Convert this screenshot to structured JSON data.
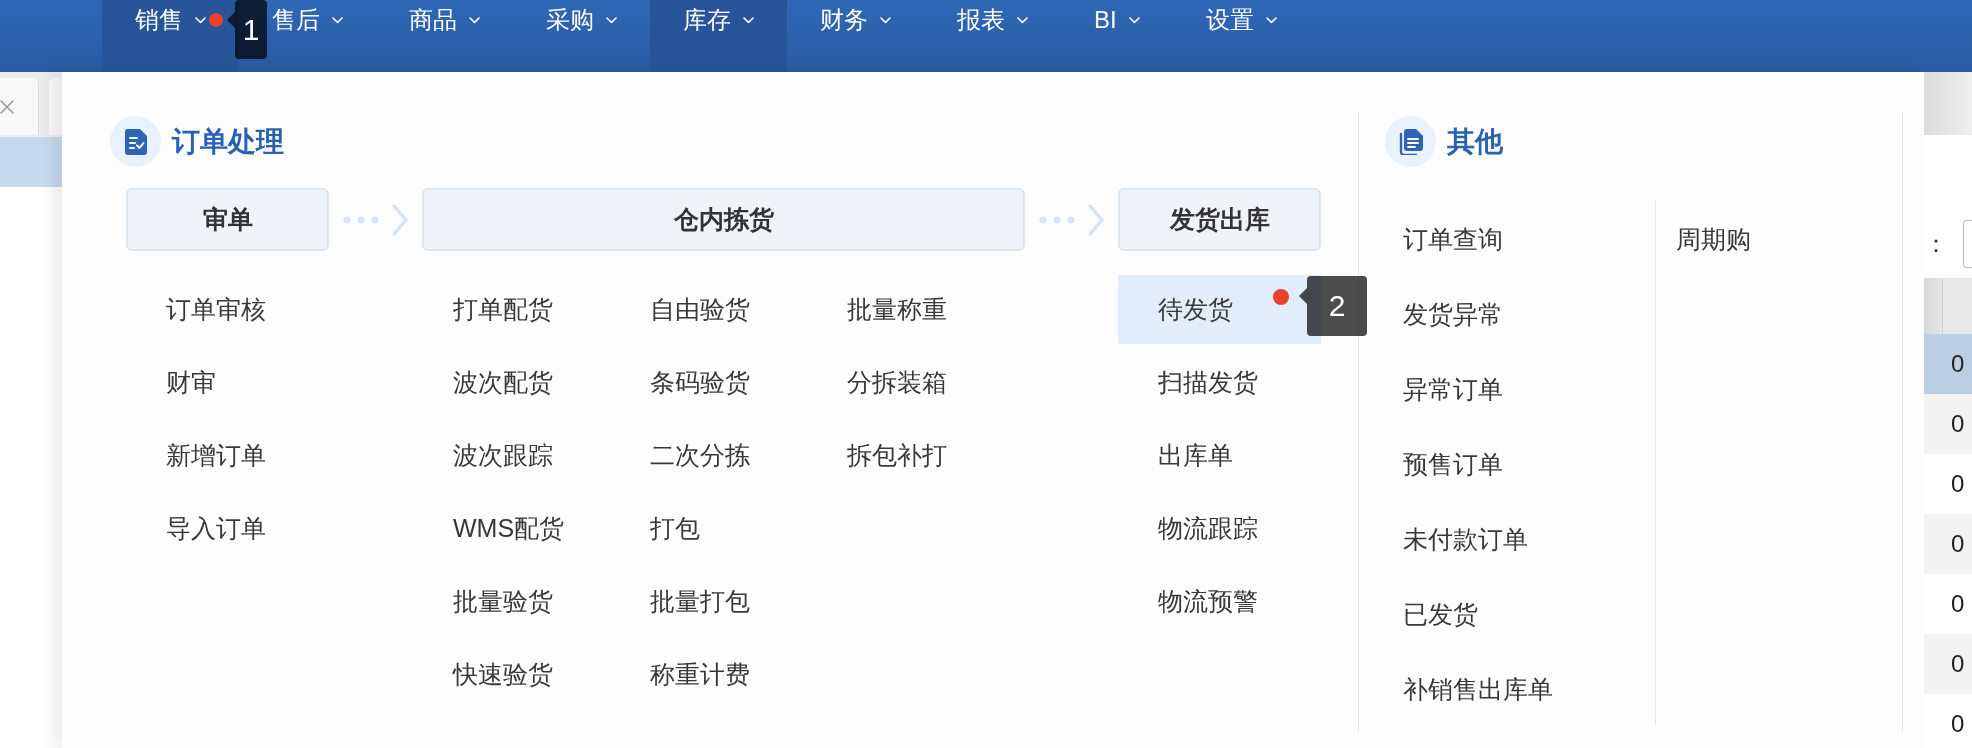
{
  "nav": {
    "items": [
      {
        "label": "销售",
        "highlighted": true,
        "annotation": "1"
      },
      {
        "label": "售后",
        "highlighted": false
      },
      {
        "label": "商品",
        "highlighted": false
      },
      {
        "label": "采购",
        "highlighted": false
      },
      {
        "label": "库存",
        "highlighted": true
      },
      {
        "label": "财务",
        "highlighted": false
      },
      {
        "label": "报表",
        "highlighted": false
      },
      {
        "label": "BI",
        "highlighted": false
      },
      {
        "label": "设置",
        "highlighted": false
      }
    ]
  },
  "menu": {
    "sections": [
      {
        "kind": "flow",
        "title": "订单处理",
        "stages": [
          {
            "label": "审单",
            "columns": [
              [
                {
                  "label": "订单审核",
                  "selected": false
                },
                {
                  "label": "财审",
                  "selected": false
                },
                {
                  "label": "新增订单",
                  "selected": false
                },
                {
                  "label": "导入订单",
                  "selected": false
                }
              ]
            ]
          },
          {
            "label": "仓内拣货",
            "columns": [
              [
                {
                  "label": "打单配货",
                  "selected": false
                },
                {
                  "label": "波次配货",
                  "selected": false
                },
                {
                  "label": "波次跟踪",
                  "selected": false
                },
                {
                  "label": "WMS配货",
                  "selected": false
                },
                {
                  "label": "批量验货",
                  "selected": false
                },
                {
                  "label": "快速验货",
                  "selected": false
                }
              ],
              [
                {
                  "label": "自由验货",
                  "selected": false
                },
                {
                  "label": "条码验货",
                  "selected": false
                },
                {
                  "label": "二次分拣",
                  "selected": false
                },
                {
                  "label": "打包",
                  "selected": false
                },
                {
                  "label": "批量打包",
                  "selected": false
                },
                {
                  "label": "称重计费",
                  "selected": false
                }
              ],
              [
                {
                  "label": "批量称重",
                  "selected": false
                },
                {
                  "label": "分拆装箱",
                  "selected": false
                },
                {
                  "label": "拆包补打",
                  "selected": false
                }
              ]
            ]
          },
          {
            "label": "发货出库",
            "columns": [
              [
                {
                  "label": "待发货",
                  "selected": true,
                  "annotation": "2"
                },
                {
                  "label": "扫描发货",
                  "selected": false
                },
                {
                  "label": "出库单",
                  "selected": false
                },
                {
                  "label": "物流跟踪",
                  "selected": false
                },
                {
                  "label": "物流预警",
                  "selected": false
                }
              ]
            ]
          }
        ]
      },
      {
        "kind": "list",
        "title": "其他",
        "columns": [
          [
            {
              "label": "订单查询",
              "selected": false
            },
            {
              "label": "发货异常",
              "selected": false
            },
            {
              "label": "异常订单",
              "selected": false
            },
            {
              "label": "预售订单",
              "selected": false
            },
            {
              "label": "未付款订单",
              "selected": false
            },
            {
              "label": "已发货",
              "selected": false
            },
            {
              "label": "补销售出库单",
              "selected": false
            }
          ],
          [
            {
              "label": "周期购",
              "selected": false
            }
          ]
        ]
      }
    ]
  },
  "page": {
    "side_rows": [
      {
        "selected": true
      }
    ],
    "field_label": "：",
    "table_rows": [
      {
        "cell": "0",
        "selected": true
      },
      {
        "cell": "0",
        "selected": false
      },
      {
        "cell": "0",
        "selected": false
      },
      {
        "cell": "0",
        "selected": false
      },
      {
        "cell": "0",
        "selected": false
      },
      {
        "cell": "0",
        "selected": false
      },
      {
        "cell": "0",
        "selected": false
      }
    ]
  }
}
